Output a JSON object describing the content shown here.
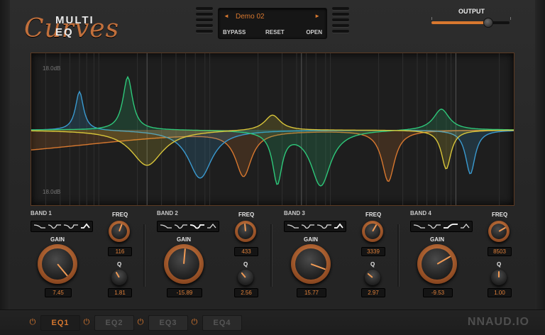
{
  "header": {
    "logo_small": "MULTI EQ",
    "logo_big": "Curves",
    "preset_name": "Demo 02",
    "prev_arrow": "◄",
    "next_arrow": "►",
    "bypass_label": "BYPASS",
    "reset_label": "RESET",
    "open_label": "OPEN",
    "output_label": "OUTPUT",
    "output_level": 0.72
  },
  "graph": {
    "top_db_label": "18.0dB",
    "bottom_db_label": "18.0dB",
    "colors": {
      "band1": "#d8782f",
      "band2": "#3a9ad0",
      "band3": "#2ec87a",
      "band4": "#d8c53a",
      "grid": "#2e2e2e"
    }
  },
  "bands": [
    {
      "name": "BAND 1",
      "freq_label": "FREQ",
      "gain_label": "GAIN",
      "q_label": "Q",
      "freq": "116",
      "gain": "7.45",
      "q": "1.81"
    },
    {
      "name": "BAND 2",
      "freq_label": "FREQ",
      "gain_label": "GAIN",
      "q_label": "Q",
      "freq": "433",
      "gain": "-15.89",
      "q": "2.56"
    },
    {
      "name": "BAND 3",
      "freq_label": "FREQ",
      "gain_label": "GAIN",
      "q_label": "Q",
      "freq": "3339",
      "gain": "15.77",
      "q": "2.97"
    },
    {
      "name": "BAND 4",
      "freq_label": "FREQ",
      "gain_label": "GAIN",
      "q_label": "Q",
      "freq": "8503",
      "gain": "-9.53",
      "q": "1.00"
    }
  ],
  "footer": {
    "tabs": [
      "EQ1",
      "EQ2",
      "EQ3",
      "EQ4"
    ],
    "active_tab": "EQ1",
    "power_icon": "⏻",
    "brand": "NNAUD.IO"
  },
  "accent_color": "#d8782f"
}
